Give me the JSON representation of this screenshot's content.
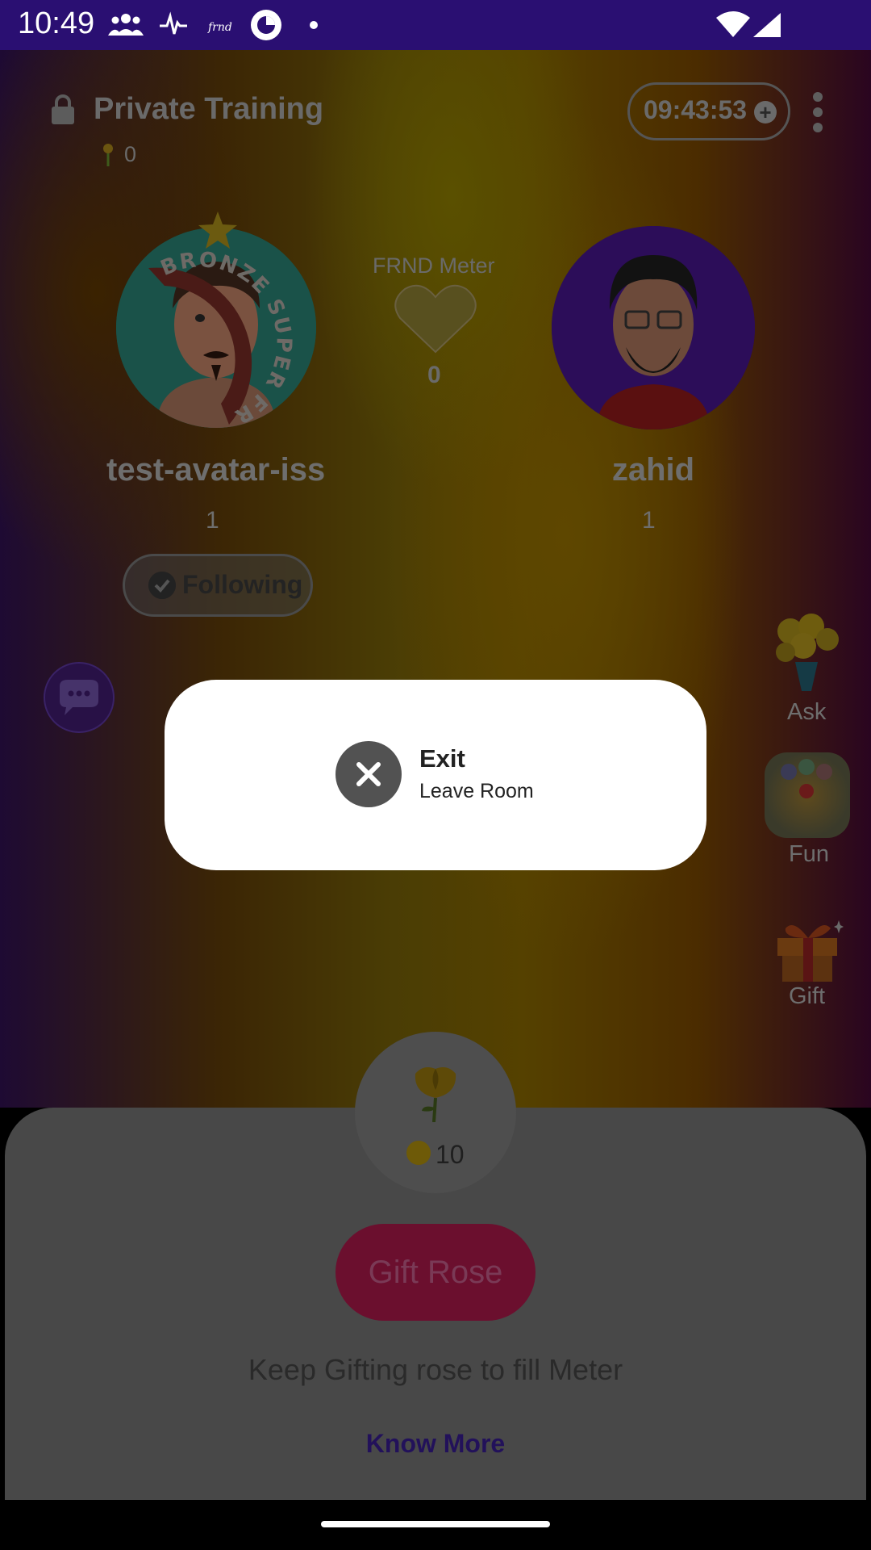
{
  "status_bar": {
    "time": "10:49"
  },
  "room": {
    "title": "Private Training",
    "rose_count": "0",
    "timer": "09:43:53",
    "timer_plus": "+"
  },
  "left_user": {
    "name": "test-avatar-iss",
    "level": "1",
    "badge_text": "BRONZE SUPER FRND",
    "follow_label": "Following"
  },
  "right_user": {
    "name": "zahid",
    "level": "1"
  },
  "meter": {
    "label": "FRND Meter",
    "value": "0"
  },
  "side_actions": [
    {
      "label": "Ask",
      "icon": "bouquet-icon"
    },
    {
      "label": "Fun",
      "icon": "game-icon"
    },
    {
      "label": "Gift",
      "icon": "gift-icon"
    }
  ],
  "sheet": {
    "rose_price": "10",
    "gift_button": "Gift Rose",
    "hint": "Keep Gifting rose to fill Meter",
    "know_more": "Know More"
  },
  "dialog": {
    "title": "Exit",
    "subtitle": "Leave Room"
  },
  "colors": {
    "status_bar": "#2a0f72",
    "dialog_bg": "#ffffff",
    "gift_button": "#6b0f2e",
    "know_more": "#22115a"
  }
}
